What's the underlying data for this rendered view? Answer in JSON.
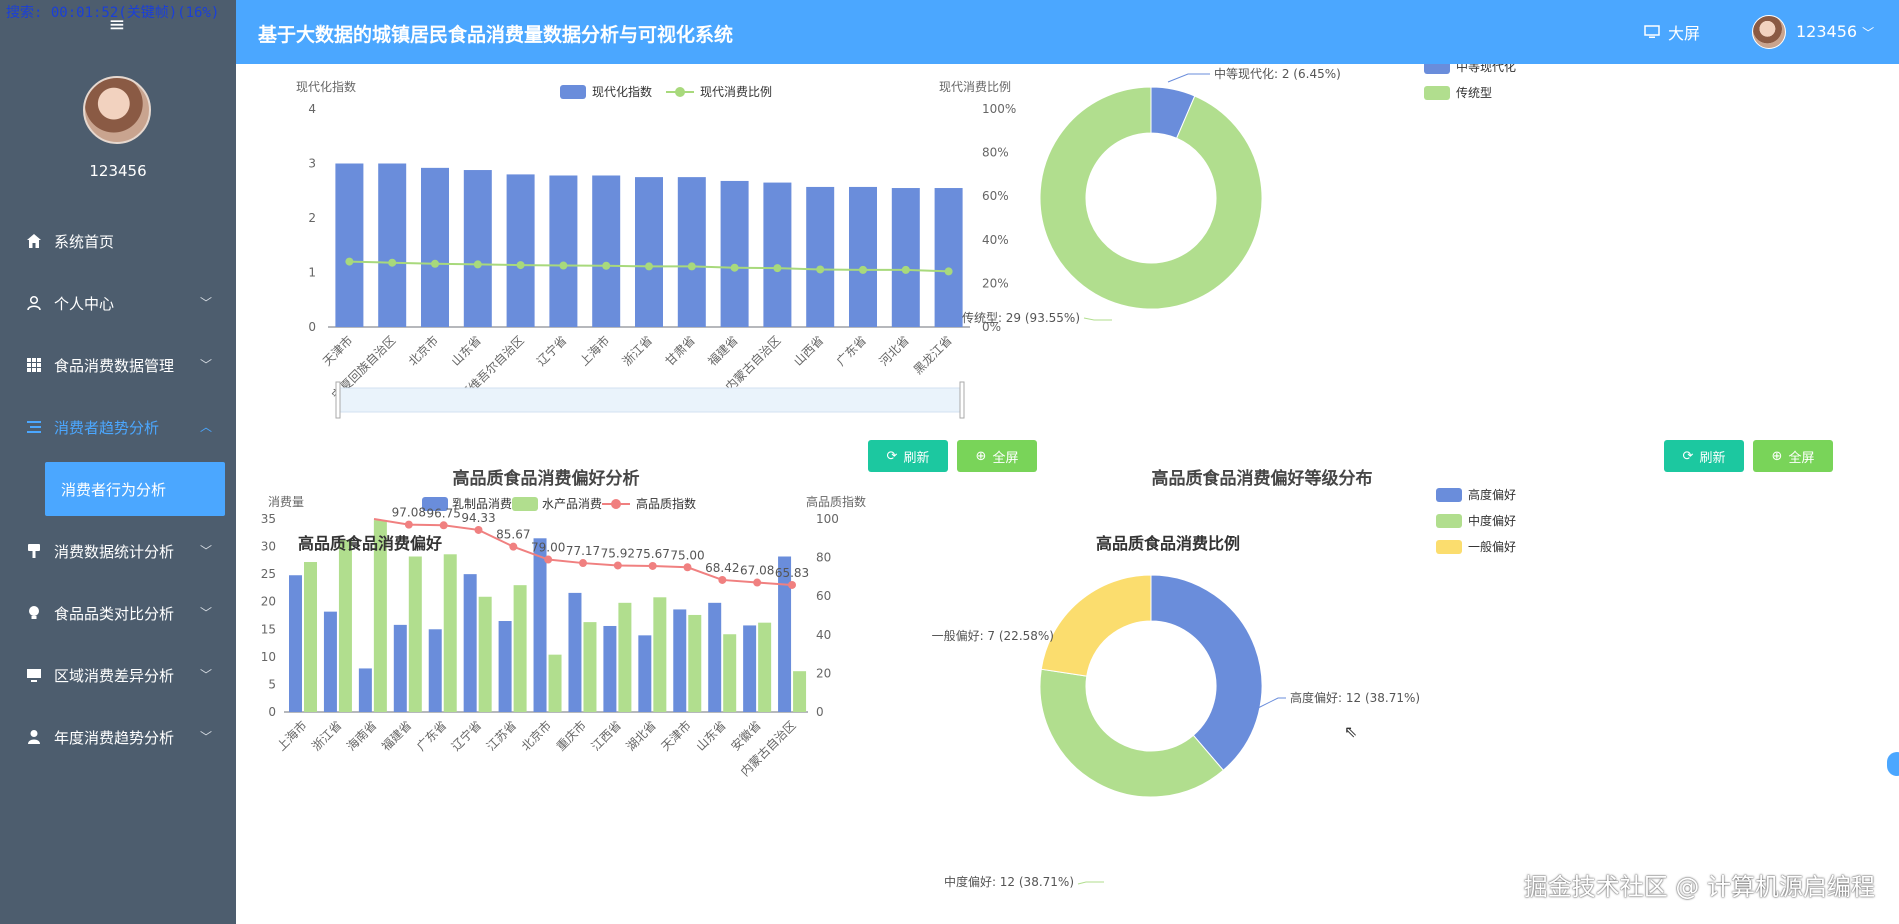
{
  "overlay": "搜索: 00:01:52(关键帧)(16%)",
  "sidebar": {
    "username": "123456",
    "items": [
      {
        "label": "系统首页",
        "icon": "home-icon"
      },
      {
        "label": "个人中心",
        "icon": "user-icon"
      },
      {
        "label": "食品消费数据管理",
        "icon": "grid-icon"
      },
      {
        "label": "消费者趋势分析",
        "icon": "list-icon"
      },
      {
        "label": "消费数据统计分析",
        "icon": "brush-icon"
      },
      {
        "label": "食品品类对比分析",
        "icon": "bulb-icon"
      },
      {
        "label": "区域消费差异分析",
        "icon": "monitor-icon"
      },
      {
        "label": "年度消费趋势分析",
        "icon": "person-icon"
      }
    ],
    "active_sub": "消费者行为分析"
  },
  "header": {
    "title": "基于大数据的城镇居民食品消费量数据分析与可视化系统",
    "screen_label": "大屏",
    "user": "123456"
  },
  "buttons": {
    "refresh": "刷新",
    "fullscreen": "全屏"
  },
  "panels": {
    "bottom_left_title": "高品质食品消费偏好",
    "bottom_right_title": "高品质食品消费比例"
  },
  "watermark": "掘金技术社区 @ 计算机源启编程",
  "chart_data": [
    {
      "type": "bar",
      "title": "",
      "ylabel_left": "现代化指数",
      "ylabel_right": "现代消费比例",
      "legend": [
        "现代化指数",
        "现代消费比例"
      ],
      "categories": [
        "天津市",
        "宁夏回族自治区",
        "北京市",
        "山东省",
        "新疆维吾尔自治区",
        "辽宁省",
        "上海市",
        "浙江省",
        "甘肃省",
        "福建省",
        "内蒙古自治区",
        "山西省",
        "广东省",
        "河北省",
        "黑龙江省"
      ],
      "series": [
        {
          "name": "现代化指数",
          "type": "bar",
          "values": [
            3.0,
            3.0,
            2.92,
            2.88,
            2.8,
            2.78,
            2.78,
            2.75,
            2.75,
            2.68,
            2.65,
            2.57,
            2.57,
            2.55,
            2.55
          ]
        },
        {
          "name": "现代消费比例",
          "type": "line",
          "axis": "right",
          "values": [
            30,
            29.5,
            29,
            28.7,
            28.4,
            28.2,
            28.1,
            27.8,
            27.8,
            27.2,
            27,
            26.4,
            26.2,
            26.2,
            25.5
          ]
        }
      ],
      "ylim_left": [
        0,
        4
      ],
      "yticks_left": [
        "0",
        "1",
        "2",
        "3",
        "4"
      ],
      "ylim_right": [
        0,
        100
      ],
      "yticks_right": [
        "0%",
        "20%",
        "40%",
        "60%",
        "80%",
        "100%"
      ]
    },
    {
      "type": "pie",
      "title": "",
      "legend": [
        "中等现代化",
        "传统型"
      ],
      "labels": [
        "中等现代化: 2 (6.45%)",
        "传统型: 29 (93.55%)"
      ],
      "values": [
        2,
        29
      ],
      "colors": [
        "#6a8ddb",
        "#b1de8e"
      ]
    },
    {
      "type": "bar",
      "title": "高品质食品消费偏好分析",
      "ylabel_left": "消费量",
      "ylabel_right": "高品质指数",
      "legend": [
        "乳制品消费",
        "水产品消费",
        "高品质指数"
      ],
      "categories": [
        "上海市",
        "浙江省",
        "海南省",
        "福建省",
        "广东省",
        "辽宁省",
        "江苏省",
        "北京市",
        "重庆市",
        "江西省",
        "湖北省",
        "天津市",
        "山东省",
        "安徽省",
        "内蒙古自治区"
      ],
      "series": [
        {
          "name": "乳制品消费",
          "type": "bar",
          "values": [
            24.8,
            18.2,
            7.9,
            15.8,
            15,
            25,
            16.5,
            31.5,
            21.6,
            15.6,
            13.9,
            18.6,
            19.8,
            15.7,
            28.2
          ]
        },
        {
          "name": "水产品消费",
          "type": "bar",
          "values": [
            27.2,
            31.2,
            34.8,
            28.2,
            28.6,
            20.9,
            23,
            10.4,
            16.3,
            19.8,
            20.8,
            17.6,
            14.1,
            16.2,
            7.4
          ]
        },
        {
          "name": "高品质指数",
          "type": "line",
          "axis": "right",
          "values": [
            100,
            97.08,
            96.75,
            94.33,
            85.67,
            79.0,
            77.17,
            75.92,
            75.67,
            75.0,
            68.42,
            67.08,
            65.83
          ],
          "labels": [
            "97.08",
            "96.75",
            "94.33",
            "85.67",
            "79.00",
            "77.17",
            "75.92",
            "75.67",
            "75.00",
            "68.42",
            "67.08",
            "65.83"
          ]
        }
      ],
      "ylim_left": [
        0,
        35
      ],
      "yticks_left": [
        "0",
        "5",
        "10",
        "15",
        "20",
        "25",
        "30",
        "35"
      ],
      "ylim_right": [
        0,
        100
      ],
      "yticks_right": [
        "0",
        "20",
        "40",
        "60",
        "80",
        "100"
      ]
    },
    {
      "type": "pie",
      "title": "高品质食品消费偏好等级分布",
      "legend": [
        "高度偏好",
        "中度偏好",
        "一般偏好"
      ],
      "labels": [
        "高度偏好: 12 (38.71%)",
        "中度偏好: 12 (38.71%)",
        "一般偏好: 7 (22.58%)"
      ],
      "values": [
        12,
        12,
        7
      ],
      "colors": [
        "#6a8ddb",
        "#b1de8e",
        "#fbdd6e"
      ]
    }
  ]
}
